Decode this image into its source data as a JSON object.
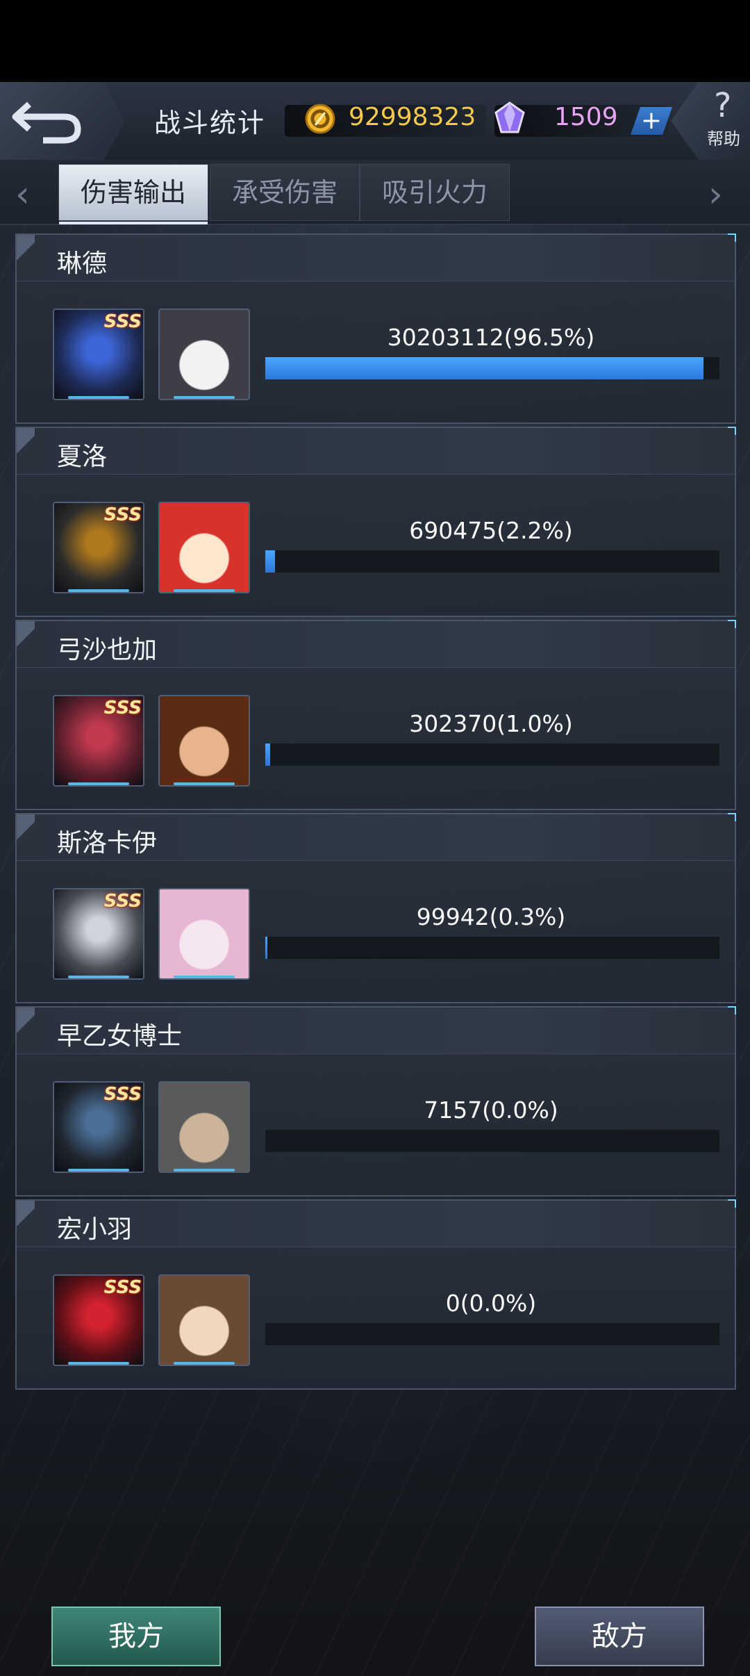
{
  "header": {
    "title": "战斗统计",
    "coins": "92998323",
    "gems": "1509",
    "plus_label": "+",
    "help_label": "帮助",
    "help_icon": "?"
  },
  "tabs": [
    {
      "label": "伤害输出",
      "active": true
    },
    {
      "label": "承受伤害",
      "active": false
    },
    {
      "label": "吸引火力",
      "active": false
    }
  ],
  "nav": {
    "left_arrow": "‹",
    "right_arrow": "›"
  },
  "rows": [
    {
      "name": "琳德",
      "stat": "30203112(96.5%)",
      "percent": 96.5,
      "rank": "SSS"
    },
    {
      "name": "夏洛",
      "stat": "690475(2.2%)",
      "percent": 2.2,
      "rank": "SSS"
    },
    {
      "name": "弓沙也加",
      "stat": "302370(1.0%)",
      "percent": 1.0,
      "rank": "SSS"
    },
    {
      "name": "斯洛卡伊",
      "stat": "99942(0.3%)",
      "percent": 0.3,
      "rank": "SSS"
    },
    {
      "name": "早乙女博士",
      "stat": "7157(0.0%)",
      "percent": 0.0,
      "rank": "SSS"
    },
    {
      "name": "宏小羽",
      "stat": "0(0.0%)",
      "percent": 0.0,
      "rank": "SSS"
    }
  ],
  "footer": {
    "ours_label": "我方",
    "enemy_label": "敌方"
  },
  "colors": {
    "bar": "#2b78d8",
    "coin_text": "#f6c94a",
    "gem_text": "#e7a4f4"
  }
}
